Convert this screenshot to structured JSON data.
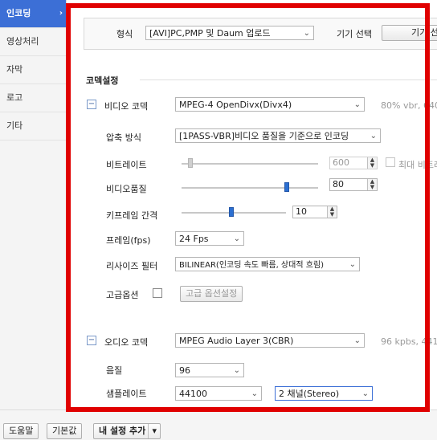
{
  "sidebar": {
    "items": [
      {
        "label": "인코딩",
        "active": true
      },
      {
        "label": "영상처리"
      },
      {
        "label": "자막"
      },
      {
        "label": "로고"
      },
      {
        "label": "기타"
      }
    ],
    "chevron": "›"
  },
  "top": {
    "format_label": "형식",
    "format_value": "[AVI]PC,PMP 및 Daum 업로드",
    "device_label": "기기 선택",
    "device_button": "기기 선"
  },
  "codec": {
    "section_title": "코덱설정",
    "video": {
      "toggle": "−",
      "label": "비디오 코덱",
      "value": "MPEG-4 OpenDivx(Divx4)",
      "info": "80% vbr, 640",
      "compress_label": "압축 방식",
      "compress_value": "[1PASS-VBR]비디오 품질을 기준으로 인코딩",
      "bitrate_label": "비트레이트",
      "bitrate_value": "600",
      "bitrate_max_label": "최대 비트레",
      "quality_label": "비디오품질",
      "quality_value": "80",
      "quality_level": 0.77,
      "keyframe_label": "키프레임 간격",
      "keyframe_value": "10",
      "keyframe_level": 0.48,
      "fps_label": "프레임(fps)",
      "fps_value": "24 Fps",
      "resize_label": "리사이즈 필터",
      "resize_value": "BILINEAR(인코딩 속도 빠름, 상대적 흐림)",
      "adv_label": "고급옵션",
      "adv_button": "고급 옵션설정"
    },
    "audio": {
      "toggle": "−",
      "label": "오디오 코덱",
      "value": "MPEG Audio Layer 3(CBR)",
      "info": "96 kpbs, 441",
      "quality_label": "음질",
      "quality_value": "96",
      "samplerate_label": "샘플레이트",
      "samplerate_value": "44100",
      "channel_value": "2 채널(Stereo)"
    },
    "arrow": "⌄"
  },
  "bottom": {
    "help": "도움말",
    "default": "기본값",
    "add_setting": "내 설정 추가",
    "dropdown": "▾"
  },
  "colors": {
    "highlight": "#e00000",
    "sidebar_active": "#3c6fd6",
    "slider_thumb": "#2b6fd1"
  }
}
